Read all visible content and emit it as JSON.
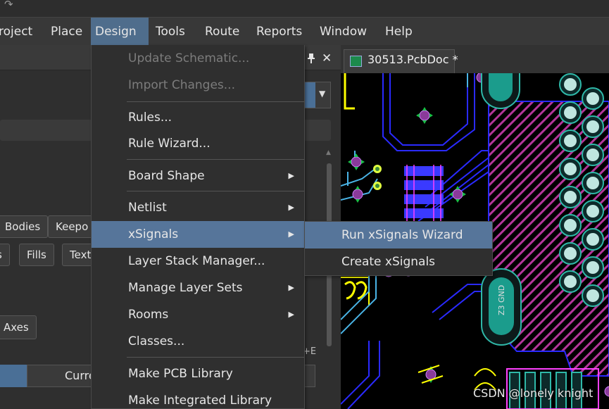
{
  "menubar": {
    "items": [
      "roject",
      "Place",
      "Design",
      "Tools",
      "Route",
      "Reports",
      "Window",
      "Help"
    ],
    "active": "Design"
  },
  "design_menu": {
    "items": [
      {
        "label": "Update Schematic...",
        "disabled": true
      },
      {
        "label": "Import Changes...",
        "disabled": true
      },
      {
        "label": "Rules..."
      },
      {
        "label": "Rule Wizard..."
      },
      {
        "label": "Board Shape",
        "submenu": true
      },
      {
        "label": "Netlist",
        "submenu": true
      },
      {
        "label": "xSignals",
        "submenu": true,
        "highlighted": true
      },
      {
        "label": "Layer Stack Manager..."
      },
      {
        "label": "Manage Layer Sets",
        "submenu": true
      },
      {
        "label": "Rooms",
        "submenu": true
      },
      {
        "label": "Classes..."
      },
      {
        "label": "Make PCB Library"
      },
      {
        "label": "Make Integrated Library"
      }
    ]
  },
  "xsignals_submenu": {
    "items": [
      {
        "label": "Run xSignals Wizard",
        "highlighted": true
      },
      {
        "label": "Create xSignals"
      }
    ]
  },
  "left_panel": {
    "chips_row1": [
      "Bodies",
      "Keepo"
    ],
    "chips_row2": [
      "s",
      "Fills",
      "Text"
    ],
    "axes_button": "Axes",
    "tab_label": "Curre",
    "shortcut_fragment": "+E"
  },
  "document": {
    "tab_label": "30513.PcbDoc *"
  },
  "watermark": "CSDN @lonely knight",
  "colors": {
    "menu_highlight": "#56759a",
    "menubar_active": "#4f6d8c",
    "pcb_background": "#000000",
    "track_blue": "#2a2aff",
    "pad_teal": "#1b9c8c",
    "silk_yellow": "#ffff00",
    "hatch_magenta": "#b4369a"
  },
  "icons": {
    "redo": "redo-icon",
    "pin": "pin-icon",
    "close": "close-icon",
    "submenu_arrow": "chevron-right-icon",
    "pcbdoc": "pcbdoc-icon"
  }
}
